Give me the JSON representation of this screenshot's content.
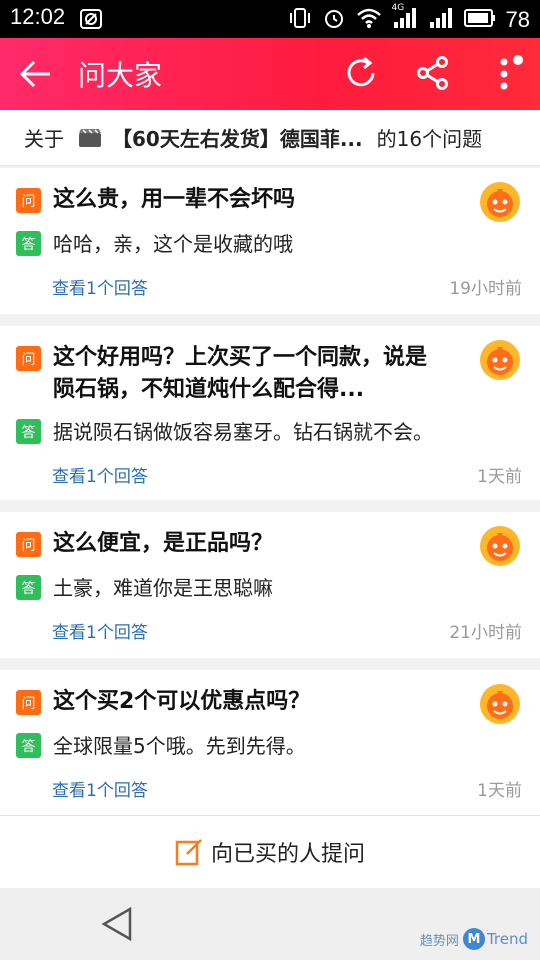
{
  "status_bar": {
    "time": "12:02",
    "network": "4G",
    "battery": "78"
  },
  "header": {
    "title": "问大家"
  },
  "subject": {
    "prefix": "关于",
    "product": "【60天左右发货】德国菲...",
    "suffix": "的16个问题"
  },
  "questions": [
    {
      "tag_q": "问",
      "question": "这么贵，用一辈不会坏吗",
      "tag_a": "答",
      "answer": "哈哈，亲，这个是收藏的哦",
      "link": "查看1个回答",
      "time": "19小时前"
    },
    {
      "tag_q": "问",
      "question": "这个好用吗？上次买了一个同款，说是陨石锅，不知道炖什么配合得...",
      "tag_a": "答",
      "answer": "据说陨石锅做饭容易塞牙。钻石锅就不会。",
      "link": "查看1个回答",
      "time": "1天前"
    },
    {
      "tag_q": "问",
      "question": "这么便宜，是正品吗？",
      "tag_a": "答",
      "answer": "土豪，难道你是王思聪嘛",
      "link": "查看1个回答",
      "time": "21小时前"
    },
    {
      "tag_q": "问",
      "question": "这个买2个可以优惠点吗？",
      "tag_a": "答",
      "answer": "全球限量5个哦。先到先得。",
      "link": "查看1个回答",
      "time": "1天前"
    }
  ],
  "ask": {
    "label": "向已买的人提问"
  },
  "watermark": {
    "cn": "趋势网",
    "m": "M",
    "en": "Trend"
  },
  "colors": {
    "header_start": "#ff2a6a",
    "header_end": "#ff1b3d",
    "question_tag": "#ff6a13",
    "answer_tag": "#2fbf5a",
    "link": "#2a6fb3",
    "time": "#9a9a9a"
  },
  "icons": [
    "back-arrow-icon",
    "refresh-icon",
    "share-icon",
    "more-icon",
    "product-icon",
    "avatar-icon",
    "edit-icon",
    "nav-back-icon"
  ]
}
